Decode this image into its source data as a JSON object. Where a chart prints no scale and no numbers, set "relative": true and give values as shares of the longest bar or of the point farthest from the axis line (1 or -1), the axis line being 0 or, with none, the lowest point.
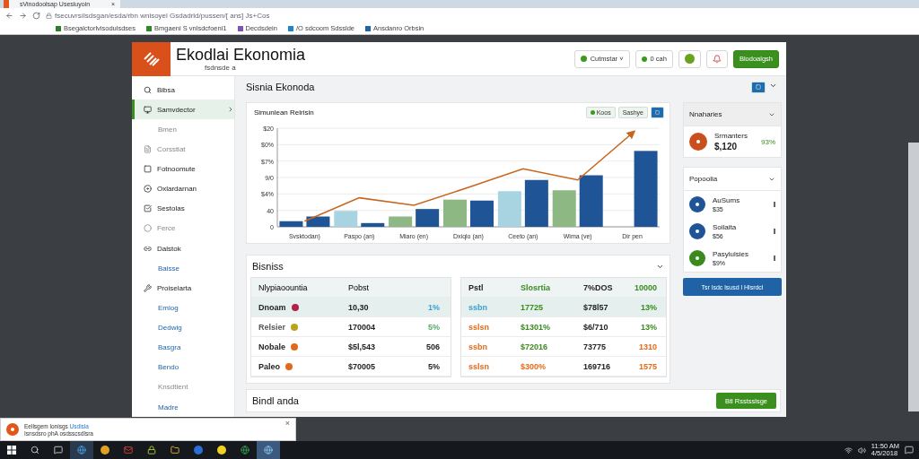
{
  "browser": {
    "tab_title": "sVinodoolsap Usesiuyoin",
    "tab_close": "×",
    "address": "fsecuvrsílsdsgan/esda/rbn wnisoyel Gsdadrld/pussen/[ ans] Js+Cos",
    "bookmarks": [
      "Bsegalctorlvisodulsdses",
      "Bmgaeni S vnlsdcfoeni1",
      "Decdsdein",
      "/O sdcoom Sdsslde",
      "Ansdanro Orbsin"
    ]
  },
  "app": {
    "title": "Ekodlai Ekonomia",
    "subtitle": "fsdnsde a",
    "header_controls": [
      {
        "kind": "select",
        "label": "Cutmstar ˅"
      },
      {
        "kind": "pill",
        "label": "0 cah"
      },
      {
        "kind": "round"
      },
      {
        "kind": "alert"
      },
      {
        "kind": "primary",
        "label": "Blodoalgsh"
      }
    ]
  },
  "sidebar": {
    "items": [
      {
        "label": "Bibsa",
        "kind": "icon",
        "selected": false
      },
      {
        "label": "Samvdector",
        "kind": "icon",
        "selected": true
      },
      {
        "label": "Bmen",
        "kind": "sub",
        "selected": false
      },
      {
        "label": "Corsstiat",
        "kind": "muted",
        "selected": false
      },
      {
        "label": "Fotnoomute",
        "kind": "icon",
        "selected": false
      },
      {
        "label": "Oxlardarnan",
        "kind": "icon",
        "selected": false
      },
      {
        "label": "Sestolas",
        "kind": "icon",
        "selected": false
      },
      {
        "label": "Ferce",
        "kind": "muted",
        "selected": false
      },
      {
        "label": "Dalstok",
        "kind": "icon",
        "selected": false
      },
      {
        "label": "Baisse",
        "kind": "link",
        "selected": false
      },
      {
        "label": "Proiselarta",
        "kind": "icon",
        "selected": false
      },
      {
        "label": "Emlog",
        "kind": "link",
        "selected": false
      },
      {
        "label": "Dedwig",
        "kind": "link",
        "selected": false
      },
      {
        "label": "Basgra",
        "kind": "link",
        "selected": false
      },
      {
        "label": "Bendo",
        "kind": "link",
        "selected": false
      },
      {
        "label": "Knsdtient",
        "kind": "sub",
        "selected": false
      },
      {
        "label": "Madre",
        "kind": "link",
        "selected": false
      }
    ]
  },
  "overview": {
    "title": "Sisnia Ekonoda",
    "chart_card": {
      "title": "Simunlean Relrisin",
      "buttons": [
        "Koos",
        "Sashye"
      ],
      "y_labels": [
        "$20",
        "$0%",
        "$7%",
        "9/0",
        "$4%",
        "40",
        "0"
      ],
      "chart_data": {
        "type": "bar",
        "relative": true,
        "categories": [
          "Svsktodan)",
          "Paspo (an)",
          "Miaro (en)",
          "Dxiqlo (an)",
          "Ceeto (an)",
          "Wima (ve)",
          "Dir pen"
        ],
        "series": [
          {
            "color": "#a8d4e2",
            "values": [
              null,
              0.17,
              null,
              null,
              0.38,
              null,
              null
            ]
          },
          {
            "color": "#8db884",
            "values": [
              null,
              null,
              0.11,
              0.29,
              null,
              0.39,
              null
            ]
          },
          {
            "color": "#1f5596",
            "values": [
              0.06,
              null,
              null,
              null,
              null,
              null,
              null
            ]
          },
          {
            "color": "#1f5596",
            "values": [
              0.11,
              0.04,
              0.19,
              0.28,
              0.5,
              0.55,
              0.81
            ]
          },
          {
            "color": "#c8651b",
            "type": "line",
            "values": [
              0.06,
              0.31,
              0.23,
              0.42,
              0.62,
              0.5,
              1
            ]
          }
        ]
      }
    },
    "side_cards": [
      {
        "title": "Nnaharies",
        "items": [
          {
            "name": "Srmanters",
            "value": "$,120",
            "change": "93%",
            "color": "#c9501c"
          }
        ]
      },
      {
        "title": "Popoolia",
        "items": [
          {
            "name": "AuSums",
            "value": "$35",
            "color": "#1f5596"
          },
          {
            "name": "Soilaita",
            "value": "$56",
            "color": "#1f5596"
          },
          {
            "name": "Pasylulsies",
            "value": "$9%",
            "color": "#3a8a1e"
          }
        ],
        "button": "Tsr lsdc lsusd l Hlsrdcl"
      }
    ]
  },
  "business": {
    "title": "Bisniss",
    "left_table": {
      "columns": [
        "Nlypiaoountia",
        "Pobst"
      ],
      "rows": [
        {
          "selected": true,
          "color": "#b0234a",
          "cells": [
            {
              "text": "Dnoam",
              "color": "#222222"
            },
            {
              "text": "10,30",
              "color": "#222222"
            },
            {
              "text": "1%",
              "color": "#3b9fd0"
            }
          ]
        },
        {
          "selected": false,
          "color": "#b8a51c",
          "cells": [
            {
              "text": "Relsier",
              "color": "#555555"
            },
            {
              "text": "170004",
              "color": "#222222"
            },
            {
              "text": "5%",
              "color": "#5aa86a"
            }
          ]
        },
        {
          "selected": false,
          "color": "#e06a1b",
          "cells": [
            {
              "text": "Nobale",
              "color": "#222222"
            },
            {
              "text": "$5l,543",
              "color": "#222222"
            },
            {
              "text": "506",
              "color": "#222222"
            }
          ]
        },
        {
          "selected": false,
          "color": "#e06a1b",
          "cells": [
            {
              "text": "Paleo",
              "color": "#222222"
            },
            {
              "text": "$70005",
              "color": "#222222"
            },
            {
              "text": "5%",
              "color": "#222222"
            }
          ]
        }
      ]
    },
    "right_table": {
      "columns": [
        {
          "text": "Pstl",
          "color": "#222222"
        },
        {
          "text": "Slosrtia",
          "color": "#3a8a1e"
        },
        {
          "text": "7%DOS",
          "color": "#222222"
        },
        {
          "text": "10000",
          "color": "#3a8a1e"
        }
      ],
      "rows": [
        {
          "selected": true,
          "cells": [
            {
              "text": "ssbn",
              "color": "#3b9fd0"
            },
            {
              "text": "17725",
              "color": "#3a8a1e"
            },
            {
              "text": "$78l57",
              "color": "#222222"
            },
            {
              "text": "13%",
              "color": "#3a8a1e"
            }
          ]
        },
        {
          "selected": false,
          "cells": [
            {
              "text": "sslsn",
              "color": "#e06a1b"
            },
            {
              "text": "$1301%",
              "color": "#3a8a1e"
            },
            {
              "text": "$6/710",
              "color": "#222222"
            },
            {
              "text": "13%",
              "color": "#3a8a1e"
            }
          ]
        },
        {
          "selected": false,
          "cells": [
            {
              "text": "ssbn",
              "color": "#e06a1b"
            },
            {
              "text": "$72016",
              "color": "#3a8a1e"
            },
            {
              "text": "73775",
              "color": "#222222"
            },
            {
              "text": "1310",
              "color": "#e06a1b"
            }
          ]
        },
        {
          "selected": false,
          "cells": [
            {
              "text": "sslsn",
              "color": "#e06a1b"
            },
            {
              "text": "$300%",
              "color": "#e06a1b"
            },
            {
              "text": "169716",
              "color": "#222222"
            },
            {
              "text": "1575",
              "color": "#e06a1b"
            }
          ]
        }
      ]
    }
  },
  "footer_card": {
    "title": "Bindl anda",
    "button": "Btl Rsstsslsge"
  },
  "notification": {
    "title": "Eellsgem lonisgs",
    "link": "Usdisla",
    "body": "Isnsdsro phA osdsscsdlsra",
    "close": "×"
  },
  "taskbar": {
    "clock_time": "11:50 AM",
    "clock_date": "4/5/2018"
  }
}
